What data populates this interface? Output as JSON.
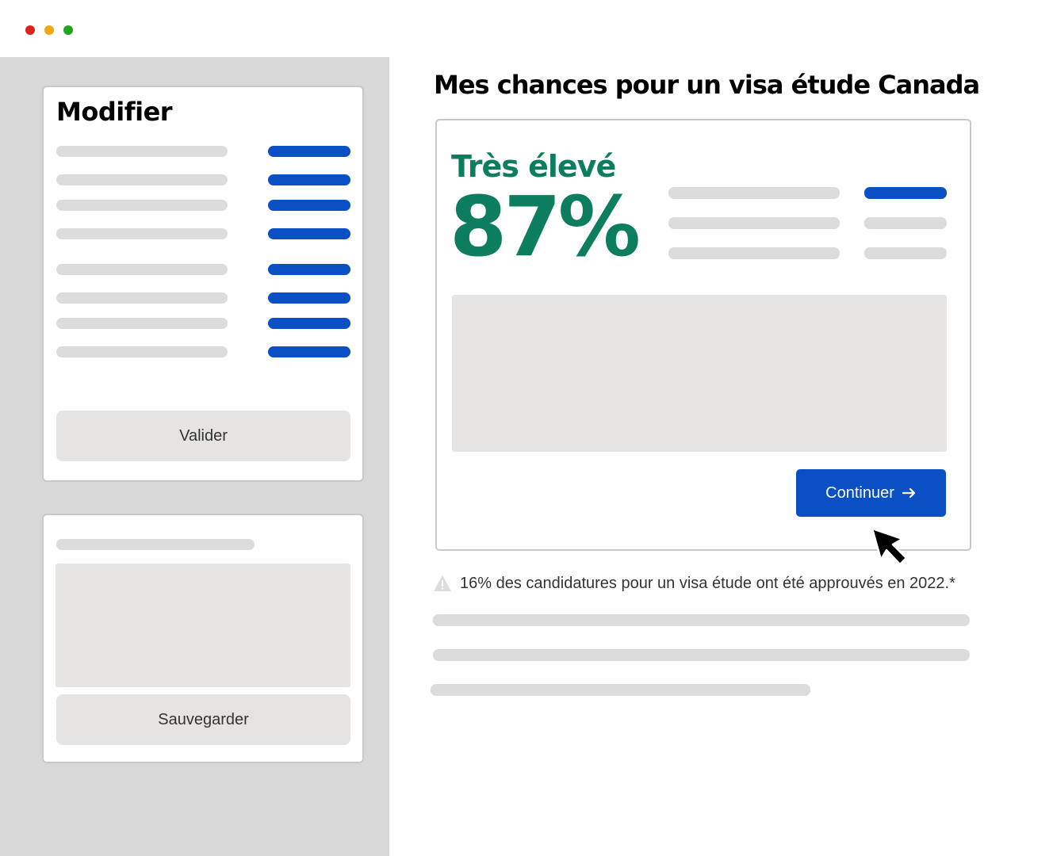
{
  "window": {
    "controls": [
      {
        "name": "close",
        "color": "#e0201c"
      },
      {
        "name": "minimize",
        "color": "#f2a815"
      },
      {
        "name": "maximize",
        "color": "#1fa51f"
      }
    ]
  },
  "sidebar": {
    "edit_card": {
      "title": "Modifier",
      "validate_label": "Valider"
    },
    "save_card": {
      "save_label": "Sauvegarder"
    }
  },
  "main": {
    "title": "Mes chances pour un visa étude Canada",
    "result": {
      "level_label": "Très élevé",
      "percent_text": "87%",
      "probability": 0.87,
      "continue_label": "Continuer",
      "continue_icon": "arrow-right-icon"
    },
    "note": {
      "icon": "warning-icon",
      "text": "16% des candidatures pour un visa étude ont été approuvés en 2022.*"
    }
  },
  "colors": {
    "accent_blue": "#0a4fc4",
    "success_green": "#0c7d5e",
    "placeholder_grey": "#dcdcdc",
    "panel_grey": "#e7e5e3",
    "sidebar_bg": "#d8d8d8"
  }
}
